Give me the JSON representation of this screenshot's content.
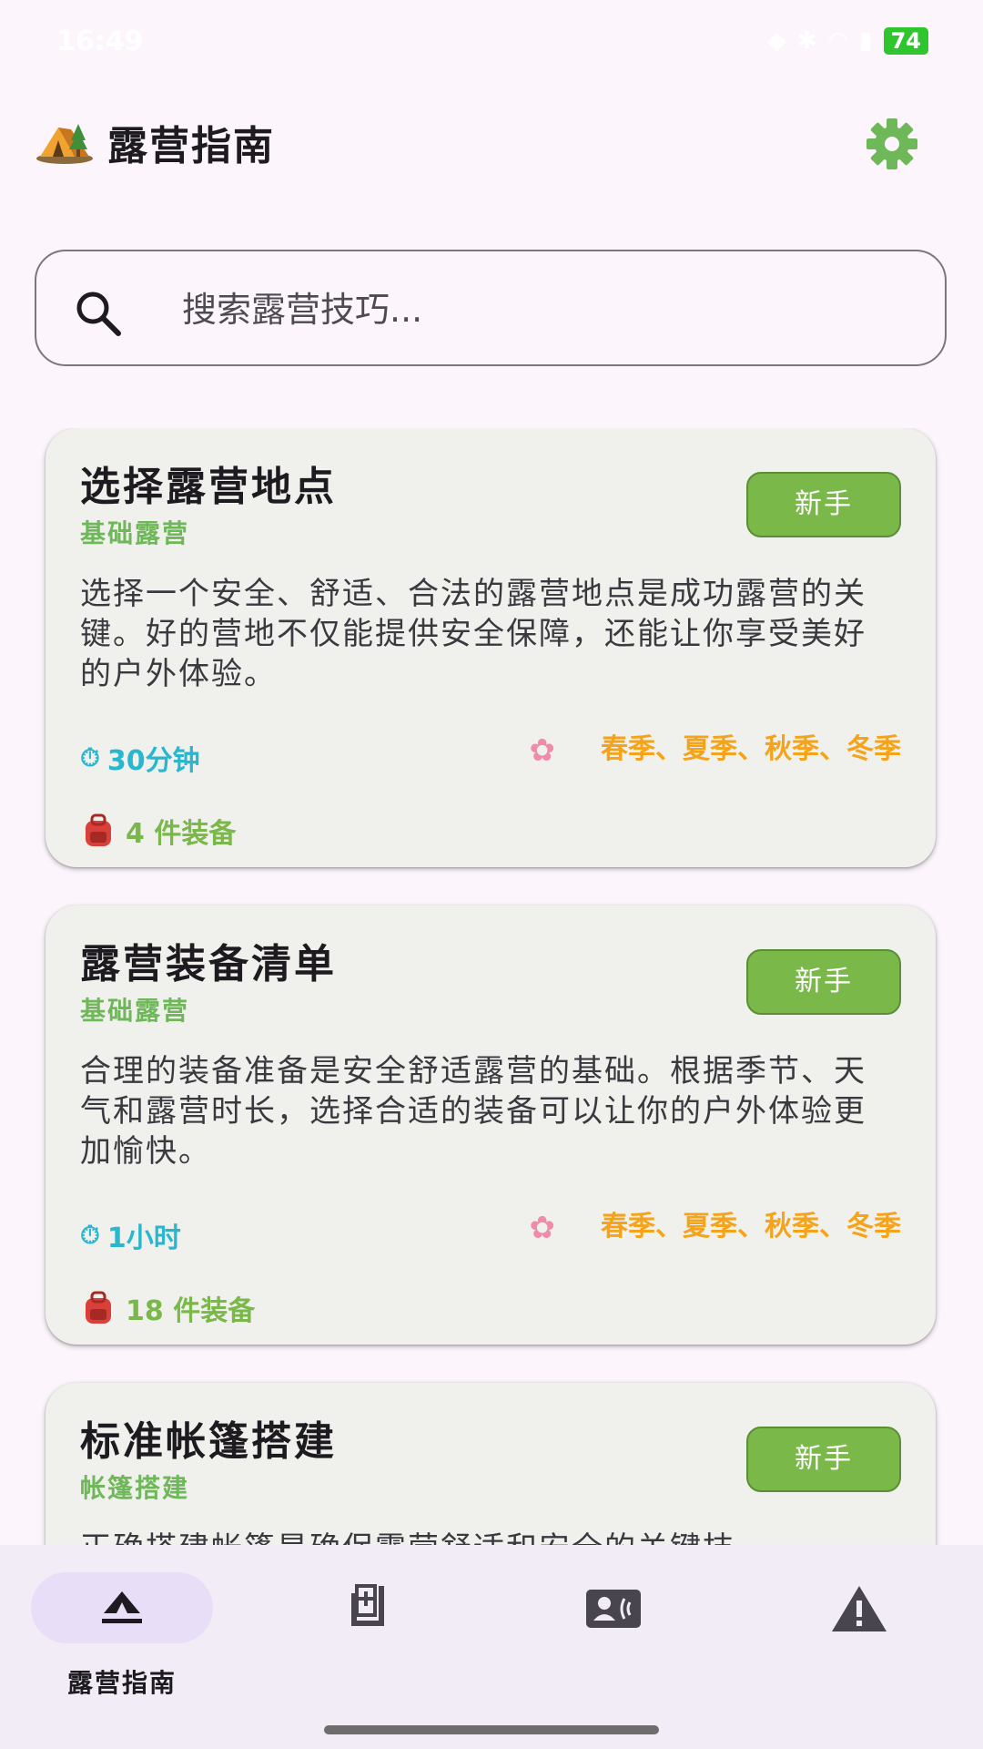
{
  "status_bar": {
    "time": "16:49",
    "battery": "74"
  },
  "header": {
    "title": "露营指南",
    "logo_icon": "camping-tent-icon",
    "settings_icon": "gear-icon"
  },
  "search": {
    "placeholder": "搜索露营技巧..."
  },
  "cards": [
    {
      "title": "选择露营地点",
      "category": "基础露营",
      "level": "新手",
      "description": "选择一个安全、舒适、合法的露营地点是成功露营的关键。好的营地不仅能提供安全保障，还能让你享受美好的户外体验。",
      "duration": "30分钟",
      "seasons": "春季、夏季、秋季、冬季",
      "gear": "4 件装备"
    },
    {
      "title": "露营装备清单",
      "category": "基础露营",
      "level": "新手",
      "description": "合理的装备准备是安全舒适露营的基础。根据季节、天气和露营时长，选择合适的装备可以让你的户外体验更加愉快。",
      "duration": "1小时",
      "seasons": "春季、夏季、秋季、冬季",
      "gear": "18 件装备"
    },
    {
      "title": "标准帐篷搭建",
      "category": "帐篷搭建",
      "level": "新手",
      "description": "正确搭建帐篷是确保露营舒适和安全的关键技",
      "duration": "",
      "seasons": "",
      "gear": ""
    }
  ],
  "bottom_nav": {
    "items": [
      {
        "label": "露营指南",
        "icon": "camping-guide-icon",
        "active": true
      },
      {
        "label": "",
        "icon": "checklist-icon",
        "active": false
      },
      {
        "label": "",
        "icon": "contact-card-icon",
        "active": false
      },
      {
        "label": "",
        "icon": "warning-icon",
        "active": false
      }
    ]
  },
  "colors": {
    "background": "#fcf6fc",
    "card": "#f0f0ec",
    "accent_green": "#7ab84a",
    "time_blue": "#29b6cf",
    "season_orange": "#f5a31a",
    "nav_bg": "#f2ecf6",
    "nav_active_pill": "#e8def8"
  }
}
